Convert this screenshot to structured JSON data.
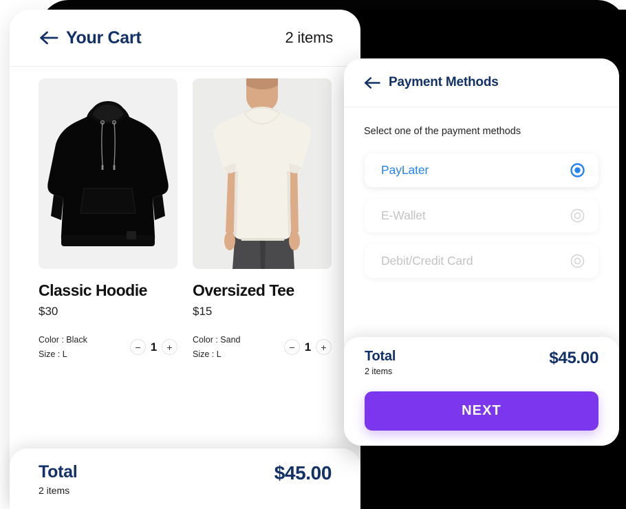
{
  "cart": {
    "back_icon": "back-arrow-icon",
    "title": "Your Cart",
    "items_count": "2 items",
    "products": [
      {
        "name": "Classic Hoodie",
        "price": "$30",
        "color_label": "Color : Black",
        "size_label": "Size : L",
        "quantity": "1",
        "decrement_label": "−",
        "increment_label": "+",
        "image": "black-hoodie-photo"
      },
      {
        "name": "Oversized Tee",
        "price": "$15",
        "color_label": "Color : Sand",
        "size_label": "Size : L",
        "quantity": "1",
        "decrement_label": "−",
        "increment_label": "+",
        "image": "cream-tshirt-model-photo"
      }
    ],
    "total": {
      "label": "Total",
      "sub": "2 items",
      "amount": "$45.00"
    }
  },
  "payment": {
    "back_icon": "back-arrow-icon",
    "title": "Payment Methods",
    "subtitle": "Select one of the payment methods",
    "options": [
      {
        "label": "PayLater",
        "selected": true
      },
      {
        "label": "E-Wallet",
        "selected": false
      },
      {
        "label": "Debit/Credit Card",
        "selected": false
      }
    ],
    "total": {
      "label": "Total",
      "sub": "2 items",
      "amount": "$45.00"
    },
    "next_label": "NEXT"
  },
  "colors": {
    "navy": "#123169",
    "blue_accent": "#2483f5",
    "purple": "#7c36ee",
    "muted_grey": "#c3c3c3",
    "photo_bg": "#f1f1f1",
    "frame_black": "#000000"
  }
}
